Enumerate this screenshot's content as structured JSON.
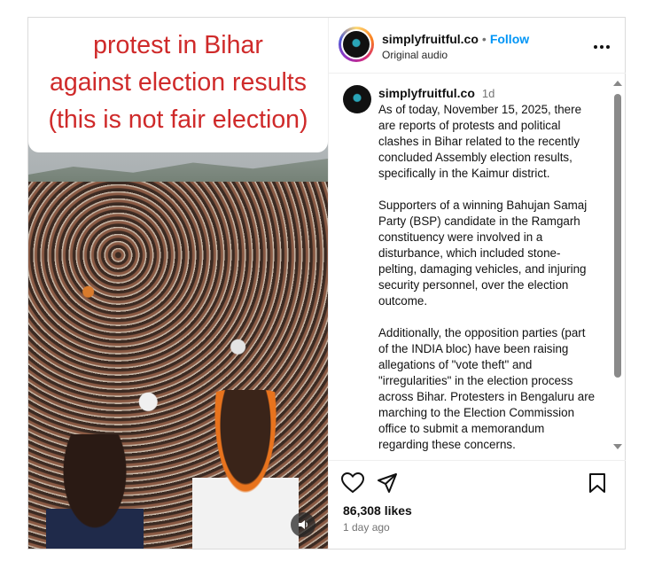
{
  "media": {
    "caption_lines": [
      "protest in Bihar",
      "against election results",
      "(this is not fair election)"
    ],
    "audio_icon": "speaker-icon"
  },
  "header": {
    "username": "simplyfruitful.co",
    "separator": "•",
    "follow_label": "Follow",
    "subtitle": "Original audio",
    "more_icon": "more-horizontal-icon"
  },
  "comment": {
    "username": "simplyfruitful.co",
    "time": "1d",
    "body": "As of today, November 15, 2025, there are reports of protests and political clashes in Bihar related to the recently concluded Assembly election results, specifically in the Kaimur district.\n\nSupporters of a winning Bahujan Samaj Party (BSP) candidate in the Ramgarh constituency were involved in a disturbance, which included stone-pelting, damaging vehicles, and injuring security personnel, over the election outcome.\n\nAdditionally, the opposition parties (part of the INDIA bloc) have been raising allegations of \"vote theft\" and \"irregularities\" in the election process across Bihar. Protesters in Bengaluru are marching to the Election Commission office to submit a memorandum regarding these concerns."
  },
  "actions": {
    "likes": "86,308 likes",
    "posted": "1 day ago",
    "icons": [
      "heart-icon",
      "share-icon",
      "bookmark-icon"
    ]
  },
  "colors": {
    "caption_red": "#cf2a2a",
    "follow_blue": "#0095f6",
    "muted_gray": "#737373"
  }
}
